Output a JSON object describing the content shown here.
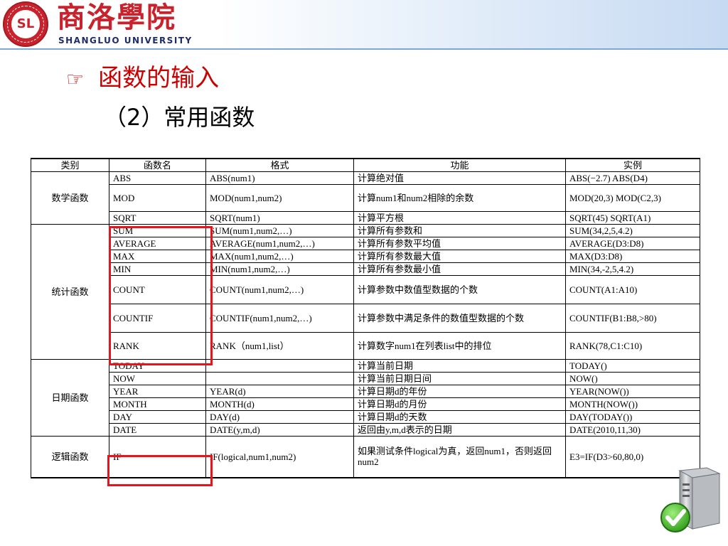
{
  "header": {
    "university_cn": "商洛學院",
    "university_en": "SHANGLUO UNIVERSITY",
    "logo_text": "SL"
  },
  "title": {
    "hand_symbol": "☞",
    "main": "函数的输入",
    "sub": "（2）常用函数"
  },
  "table": {
    "headers": [
      "类别",
      "函数名",
      "格式",
      "功能",
      "实例"
    ],
    "groups": [
      {
        "category": "数学函数",
        "rows": [
          [
            "ABS",
            "ABS(num1)",
            "计算绝对值",
            "ABS(−2.7) ABS(D4)"
          ],
          [
            "MOD",
            "MOD(num1,num2)",
            "计算num1和num2相除的余数",
            "MOD(20,3) MOD(C2,3)"
          ],
          [
            "SQRT",
            "SQRT(num1)",
            "计算平方根",
            "SQRT(45) SQRT(A1)"
          ]
        ]
      },
      {
        "category": "统计函数",
        "rows": [
          [
            "SUM",
            "SUM(num1,num2,…)",
            "计算所有参数和",
            "SUM(34,2,5,4.2)"
          ],
          [
            "AVERAGE",
            "AVERAGE(num1,num2,…)",
            "计算所有参数平均值",
            "AVERAGE(D3:D8)"
          ],
          [
            "MAX",
            "MAX(num1,num2,…)",
            "计算所有参数最大值",
            "MAX(D3:D8)"
          ],
          [
            "MIN",
            "MIN(num1,num2,…)",
            "计算所有参数最小值",
            "MIN(34,-2,5,4.2)"
          ],
          [
            "COUNT",
            "COUNT(num1,num2,…)",
            "计算参数中数值型数据的个数",
            "COUNT(A1:A10)"
          ],
          [
            "COUNTIF",
            "COUNTIF(num1,num2,…)",
            "计算参数中满足条件的数值型数据的个数",
            "COUNTIF(B1:B8,>80)"
          ],
          [
            "RANK",
            "RANK（num1,list）",
            "计算数字num1在列表list中的排位",
            "RANK(78,C1:C10)"
          ]
        ]
      },
      {
        "category": "日期函数",
        "rows": [
          [
            "TODAY",
            "",
            "计算当前日期",
            "TODAY()"
          ],
          [
            "NOW",
            "",
            "计算当前日期日间",
            "NOW()"
          ],
          [
            "YEAR",
            "YEAR(d)",
            "计算日期d的年份",
            "YEAR(NOW())"
          ],
          [
            "MONTH",
            "MONTH(d)",
            "计算日期d的月份",
            "MONTH(NOW())"
          ],
          [
            "DAY",
            "DAY(d)",
            "计算日期d的天数",
            "DAY(TODAY())"
          ],
          [
            "DATE",
            "DATE(y,m,d)",
            "返回由y,m,d表示的日期",
            "DATE(2010,11,30)"
          ]
        ]
      },
      {
        "category": "逻辑函数",
        "rows": [
          [
            "IF",
            "IF(logical,num1,num2)",
            "如果测试条件logical为真，返回num1，否则返回num2",
            "E3=IF(D3>60,80,0)"
          ]
        ]
      }
    ]
  },
  "icons": {
    "hand": "pointing-hand-icon",
    "server_check": "server-check-icon",
    "highlight_color": "#e8141a"
  }
}
